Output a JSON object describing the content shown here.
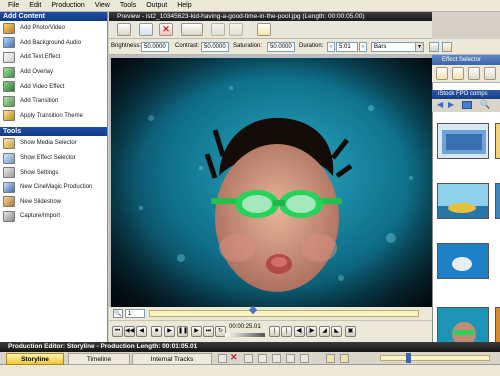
{
  "menubar": {
    "items": [
      "File",
      "Edit",
      "Production",
      "View",
      "Tools",
      "Output",
      "Help"
    ]
  },
  "left_panel": {
    "add_content_title": "Add Content",
    "add_items": [
      "Add Photo/Video",
      "Add Background Audio",
      "Add Text Effect",
      "Add Overlay",
      "Add Video Effect",
      "Add Transition",
      "Apply Transition Theme"
    ],
    "tools_title": "Tools",
    "tool_items": [
      "Show Media Selector",
      "Show Effect Selector",
      "Show Settings",
      "New CineMagic Production",
      "New Slideshow",
      "Capture/Import"
    ]
  },
  "preview": {
    "title": "Preview - ist2_10345623-kid-having-a-good-time-in-the-pool.jpg (Length: 00:00:05.00)",
    "brightness_label": "Brightness:",
    "brightness_value": "50.0000",
    "contrast_label": "Contrast:",
    "contrast_value": "50.0000",
    "saturation_label": "Saturation:",
    "saturation_value": "50.0000",
    "duration_label": "Duration:",
    "duration_value": "5.01",
    "effect_value": "Bars",
    "frame_value": "1",
    "time_code": "00:00:25.01"
  },
  "right_panel": {
    "effect_selector_tab": "Effect Selector",
    "collection_title": "iStock FPO comps"
  },
  "bottom": {
    "editor_title": "Production Editor: Storyline - Production Length: 00:01:05.01",
    "tabs": [
      "Storyline",
      "Timeline",
      "Internal Tracks"
    ]
  },
  "colors": {
    "accent_blue": "#1f4ea6",
    "dark_title": "#1a1a1a",
    "panel_bg": "#ece9d8"
  }
}
